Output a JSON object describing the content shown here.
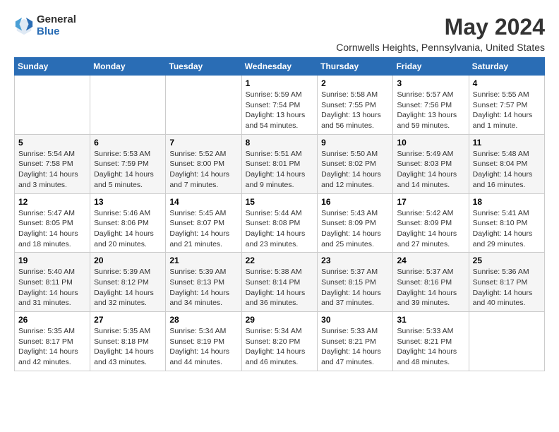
{
  "logo": {
    "general": "General",
    "blue": "Blue"
  },
  "title": "May 2024",
  "location": "Cornwells Heights, Pennsylvania, United States",
  "headers": [
    "Sunday",
    "Monday",
    "Tuesday",
    "Wednesday",
    "Thursday",
    "Friday",
    "Saturday"
  ],
  "weeks": [
    [
      {
        "day": "",
        "info": ""
      },
      {
        "day": "",
        "info": ""
      },
      {
        "day": "",
        "info": ""
      },
      {
        "day": "1",
        "info": "Sunrise: 5:59 AM\nSunset: 7:54 PM\nDaylight: 13 hours\nand 54 minutes."
      },
      {
        "day": "2",
        "info": "Sunrise: 5:58 AM\nSunset: 7:55 PM\nDaylight: 13 hours\nand 56 minutes."
      },
      {
        "day": "3",
        "info": "Sunrise: 5:57 AM\nSunset: 7:56 PM\nDaylight: 13 hours\nand 59 minutes."
      },
      {
        "day": "4",
        "info": "Sunrise: 5:55 AM\nSunset: 7:57 PM\nDaylight: 14 hours\nand 1 minute."
      }
    ],
    [
      {
        "day": "5",
        "info": "Sunrise: 5:54 AM\nSunset: 7:58 PM\nDaylight: 14 hours\nand 3 minutes."
      },
      {
        "day": "6",
        "info": "Sunrise: 5:53 AM\nSunset: 7:59 PM\nDaylight: 14 hours\nand 5 minutes."
      },
      {
        "day": "7",
        "info": "Sunrise: 5:52 AM\nSunset: 8:00 PM\nDaylight: 14 hours\nand 7 minutes."
      },
      {
        "day": "8",
        "info": "Sunrise: 5:51 AM\nSunset: 8:01 PM\nDaylight: 14 hours\nand 9 minutes."
      },
      {
        "day": "9",
        "info": "Sunrise: 5:50 AM\nSunset: 8:02 PM\nDaylight: 14 hours\nand 12 minutes."
      },
      {
        "day": "10",
        "info": "Sunrise: 5:49 AM\nSunset: 8:03 PM\nDaylight: 14 hours\nand 14 minutes."
      },
      {
        "day": "11",
        "info": "Sunrise: 5:48 AM\nSunset: 8:04 PM\nDaylight: 14 hours\nand 16 minutes."
      }
    ],
    [
      {
        "day": "12",
        "info": "Sunrise: 5:47 AM\nSunset: 8:05 PM\nDaylight: 14 hours\nand 18 minutes."
      },
      {
        "day": "13",
        "info": "Sunrise: 5:46 AM\nSunset: 8:06 PM\nDaylight: 14 hours\nand 20 minutes."
      },
      {
        "day": "14",
        "info": "Sunrise: 5:45 AM\nSunset: 8:07 PM\nDaylight: 14 hours\nand 21 minutes."
      },
      {
        "day": "15",
        "info": "Sunrise: 5:44 AM\nSunset: 8:08 PM\nDaylight: 14 hours\nand 23 minutes."
      },
      {
        "day": "16",
        "info": "Sunrise: 5:43 AM\nSunset: 8:09 PM\nDaylight: 14 hours\nand 25 minutes."
      },
      {
        "day": "17",
        "info": "Sunrise: 5:42 AM\nSunset: 8:09 PM\nDaylight: 14 hours\nand 27 minutes."
      },
      {
        "day": "18",
        "info": "Sunrise: 5:41 AM\nSunset: 8:10 PM\nDaylight: 14 hours\nand 29 minutes."
      }
    ],
    [
      {
        "day": "19",
        "info": "Sunrise: 5:40 AM\nSunset: 8:11 PM\nDaylight: 14 hours\nand 31 minutes."
      },
      {
        "day": "20",
        "info": "Sunrise: 5:39 AM\nSunset: 8:12 PM\nDaylight: 14 hours\nand 32 minutes."
      },
      {
        "day": "21",
        "info": "Sunrise: 5:39 AM\nSunset: 8:13 PM\nDaylight: 14 hours\nand 34 minutes."
      },
      {
        "day": "22",
        "info": "Sunrise: 5:38 AM\nSunset: 8:14 PM\nDaylight: 14 hours\nand 36 minutes."
      },
      {
        "day": "23",
        "info": "Sunrise: 5:37 AM\nSunset: 8:15 PM\nDaylight: 14 hours\nand 37 minutes."
      },
      {
        "day": "24",
        "info": "Sunrise: 5:37 AM\nSunset: 8:16 PM\nDaylight: 14 hours\nand 39 minutes."
      },
      {
        "day": "25",
        "info": "Sunrise: 5:36 AM\nSunset: 8:17 PM\nDaylight: 14 hours\nand 40 minutes."
      }
    ],
    [
      {
        "day": "26",
        "info": "Sunrise: 5:35 AM\nSunset: 8:17 PM\nDaylight: 14 hours\nand 42 minutes."
      },
      {
        "day": "27",
        "info": "Sunrise: 5:35 AM\nSunset: 8:18 PM\nDaylight: 14 hours\nand 43 minutes."
      },
      {
        "day": "28",
        "info": "Sunrise: 5:34 AM\nSunset: 8:19 PM\nDaylight: 14 hours\nand 44 minutes."
      },
      {
        "day": "29",
        "info": "Sunrise: 5:34 AM\nSunset: 8:20 PM\nDaylight: 14 hours\nand 46 minutes."
      },
      {
        "day": "30",
        "info": "Sunrise: 5:33 AM\nSunset: 8:21 PM\nDaylight: 14 hours\nand 47 minutes."
      },
      {
        "day": "31",
        "info": "Sunrise: 5:33 AM\nSunset: 8:21 PM\nDaylight: 14 hours\nand 48 minutes."
      },
      {
        "day": "",
        "info": ""
      }
    ]
  ]
}
